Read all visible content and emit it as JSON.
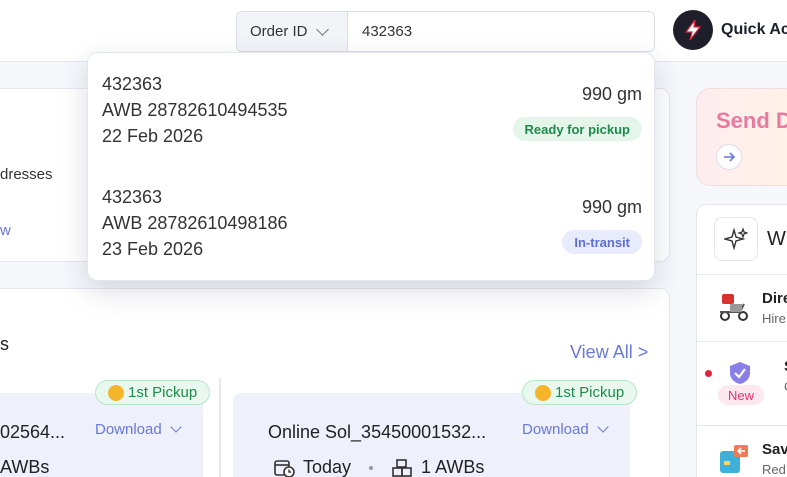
{
  "header": {
    "search_type": "Order ID",
    "search_value": "432363",
    "quick_actions_label": "Quick Act"
  },
  "left_panel": {
    "addresses_text": "dresses",
    "view_link": "w",
    "section_fragment": "s",
    "view_all": "View All >"
  },
  "shipments": [
    {
      "badge": "1st Pickup",
      "title": "02564...",
      "download": "Download",
      "awbs": "AWBs"
    },
    {
      "badge": "1st Pickup",
      "title": "Online Sol_35450001532...",
      "download": "Download",
      "date": "Today",
      "awbs": "1 AWBs"
    }
  ],
  "right_panel": {
    "send_title": "Send D",
    "wh_text": "Wh",
    "items": [
      {
        "title": "Dire",
        "sub": "Hire"
      },
      {
        "title": "S",
        "sub": "C",
        "badge": "New"
      },
      {
        "title": "Sav",
        "sub": "Red"
      }
    ]
  },
  "search_results": [
    {
      "order_id": "432363",
      "awb": "AWB 28782610494535",
      "date": "22 Feb 2026",
      "weight": "990 gm",
      "status": "Ready for pickup",
      "status_color": "#1f8a4c",
      "status_bg": "#e4f6ea"
    },
    {
      "order_id": "432363",
      "awb": "AWB 28782610498186",
      "date": "23 Feb 2026",
      "weight": "990 gm",
      "status": "In-transit",
      "status_color": "#5b6fd6",
      "status_bg": "#e8ebfb"
    }
  ]
}
